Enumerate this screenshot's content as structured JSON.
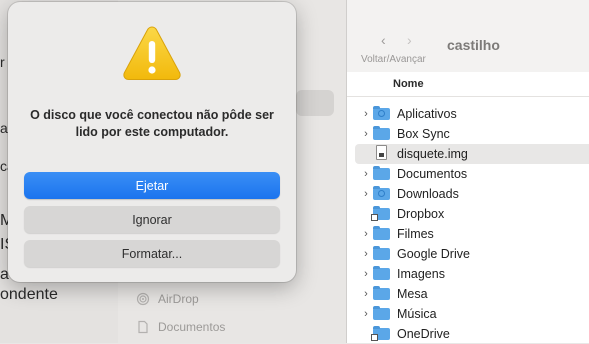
{
  "background_left": {
    "fragments": [
      "r",
      "ac",
      "ca",
      "M",
      "IS",
      "a",
      "ondente"
    ]
  },
  "sidebar": {
    "items": [
      {
        "label": "AirDrop",
        "icon": "airdrop-icon"
      },
      {
        "label": "Documentos",
        "icon": "document-icon"
      }
    ]
  },
  "finder": {
    "window_title": "castilho",
    "nav_label": "Voltar/Avançar",
    "back_glyph": "‹",
    "forward_glyph": "›",
    "column_header": "Nome",
    "rows": [
      {
        "name": "Aplicativos",
        "type": "folder",
        "expandable": true
      },
      {
        "name": "Box Sync",
        "type": "folder",
        "expandable": true
      },
      {
        "name": "disquete.img",
        "type": "file",
        "expandable": false,
        "selected": true
      },
      {
        "name": "Documentos",
        "type": "folder",
        "expandable": true
      },
      {
        "name": "Downloads",
        "type": "folder",
        "expandable": true
      },
      {
        "name": "Dropbox",
        "type": "folder",
        "expandable": false,
        "badge": true
      },
      {
        "name": "Filmes",
        "type": "folder",
        "expandable": true
      },
      {
        "name": "Google Drive",
        "type": "folder",
        "expandable": true
      },
      {
        "name": "Imagens",
        "type": "folder",
        "expandable": true
      },
      {
        "name": "Mesa",
        "type": "folder",
        "expandable": true
      },
      {
        "name": "Música",
        "type": "folder",
        "expandable": true
      },
      {
        "name": "OneDrive",
        "type": "folder",
        "expandable": false,
        "badge": true
      }
    ]
  },
  "dialog": {
    "icon": "warning-icon",
    "message": "O disco que você conectou não pôde ser lido por este computador.",
    "buttons": {
      "eject": "Ejetar",
      "ignore": "Ignorar",
      "format": "Formatar..."
    }
  },
  "colors": {
    "accent": "#1b74ee",
    "folder": "#5ba7e8",
    "warning": "#f5c21b"
  }
}
